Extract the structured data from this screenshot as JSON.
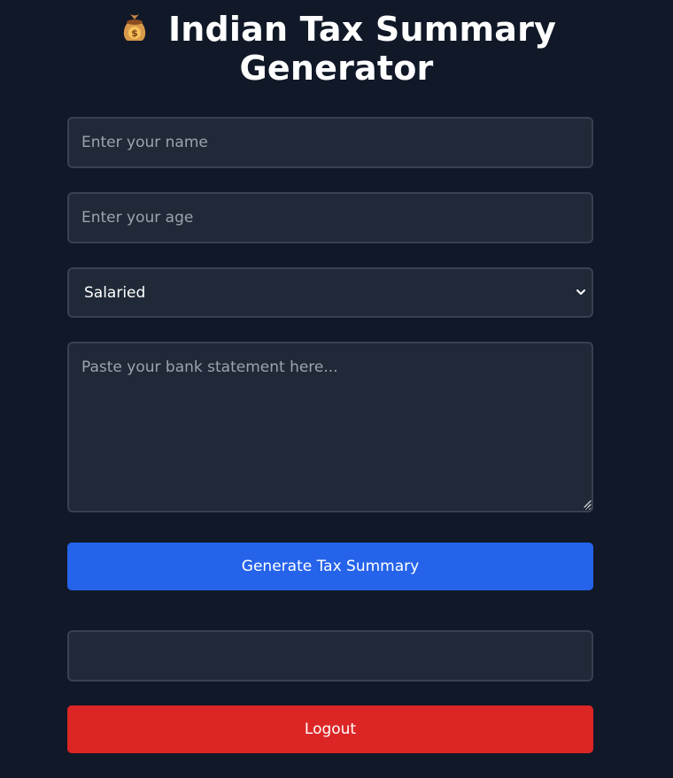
{
  "title": {
    "line1": "Indian Tax Summary",
    "line2": "Generator",
    "icon": "money-bag-icon"
  },
  "form": {
    "name_placeholder": "Enter your name",
    "age_placeholder": "Enter your age",
    "employment_type_value": "Salaried",
    "statement_placeholder": "Paste your bank statement here...",
    "generate_button_label": "Generate Tax Summary",
    "output_value": "",
    "logout_button_label": "Logout"
  },
  "colors": {
    "background": "#111827",
    "field_background": "#1f2937",
    "border": "#374151",
    "primary_button": "#2563eb",
    "danger_button": "#dc2626",
    "text": "#ffffff",
    "placeholder": "#9ca3af"
  }
}
